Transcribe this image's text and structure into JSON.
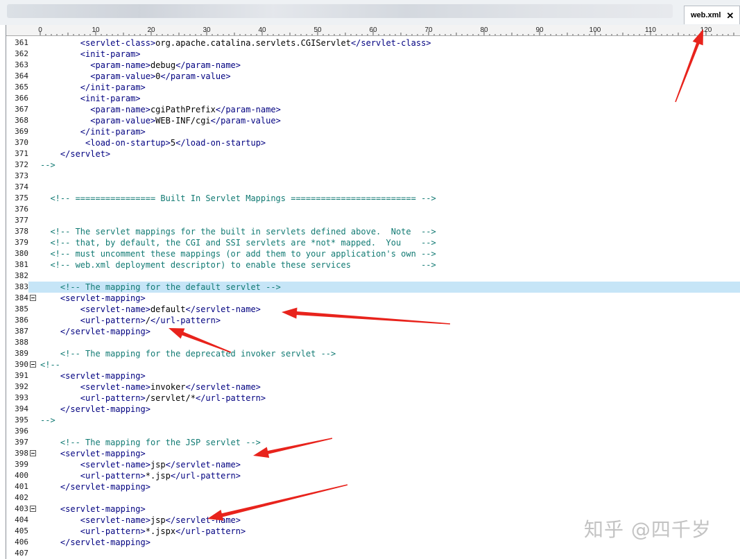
{
  "tab": {
    "title": "web.xml",
    "close": "✕"
  },
  "ruler": {
    "labels": [
      "0",
      "10",
      "20",
      "30",
      "40",
      "50",
      "60",
      "70",
      "80",
      "90",
      "100",
      "110",
      "120"
    ]
  },
  "lines": [
    {
      "n": "361",
      "indent": 8,
      "parts": [
        [
          "t",
          "<servlet-class>"
        ],
        [
          "x",
          "org.apache.catalina.servlets.CGIServlet"
        ],
        [
          "t",
          "</servlet-class>"
        ]
      ]
    },
    {
      "n": "362",
      "indent": 8,
      "parts": [
        [
          "t",
          "<init-param>"
        ]
      ]
    },
    {
      "n": "363",
      "indent": 10,
      "parts": [
        [
          "t",
          "<param-name>"
        ],
        [
          "x",
          "debug"
        ],
        [
          "t",
          "</param-name>"
        ]
      ]
    },
    {
      "n": "364",
      "indent": 10,
      "parts": [
        [
          "t",
          "<param-value>"
        ],
        [
          "x",
          "0"
        ],
        [
          "t",
          "</param-value>"
        ]
      ]
    },
    {
      "n": "365",
      "indent": 8,
      "parts": [
        [
          "t",
          "</init-param>"
        ]
      ]
    },
    {
      "n": "366",
      "indent": 8,
      "parts": [
        [
          "t",
          "<init-param>"
        ]
      ]
    },
    {
      "n": "367",
      "indent": 10,
      "parts": [
        [
          "t",
          "<param-name>"
        ],
        [
          "x",
          "cgiPathPrefix"
        ],
        [
          "t",
          "</param-name>"
        ]
      ]
    },
    {
      "n": "368",
      "indent": 10,
      "parts": [
        [
          "t",
          "<param-value>"
        ],
        [
          "x",
          "WEB-INF/cgi"
        ],
        [
          "t",
          "</param-value>"
        ]
      ]
    },
    {
      "n": "369",
      "indent": 8,
      "parts": [
        [
          "t",
          "</init-param>"
        ]
      ]
    },
    {
      "n": "370",
      "indent": 9,
      "parts": [
        [
          "t",
          "<load-on-startup>"
        ],
        [
          "x",
          "5"
        ],
        [
          "t",
          "</load-on-startup>"
        ]
      ]
    },
    {
      "n": "371",
      "indent": 4,
      "parts": [
        [
          "t",
          "</servlet>"
        ]
      ]
    },
    {
      "n": "372",
      "indent": 0,
      "parts": [
        [
          "c",
          "-->"
        ]
      ]
    },
    {
      "n": "373",
      "indent": 0,
      "parts": []
    },
    {
      "n": "374",
      "indent": 0,
      "parts": []
    },
    {
      "n": "375",
      "indent": 2,
      "parts": [
        [
          "c",
          "<!-- ================ Built In Servlet Mappings ========================= -->"
        ]
      ]
    },
    {
      "n": "376",
      "indent": 0,
      "parts": []
    },
    {
      "n": "377",
      "indent": 0,
      "parts": []
    },
    {
      "n": "378",
      "indent": 2,
      "parts": [
        [
          "c",
          "<!-- The servlet mappings for the built in servlets defined above.  Note  -->"
        ]
      ]
    },
    {
      "n": "379",
      "indent": 2,
      "parts": [
        [
          "c",
          "<!-- that, by default, the CGI and SSI servlets are *not* mapped.  You    -->"
        ]
      ]
    },
    {
      "n": "380",
      "indent": 2,
      "parts": [
        [
          "c",
          "<!-- must uncomment these mappings (or add them to your application's own -->"
        ]
      ]
    },
    {
      "n": "381",
      "indent": 2,
      "parts": [
        [
          "c",
          "<!-- web.xml deployment descriptor) to enable these services              -->"
        ]
      ]
    },
    {
      "n": "382",
      "indent": 0,
      "parts": []
    },
    {
      "n": "383",
      "indent": 4,
      "hl": true,
      "parts": [
        [
          "c",
          "<!-- The mapping for the default servlet -->"
        ]
      ]
    },
    {
      "n": "384",
      "indent": 4,
      "fold": true,
      "parts": [
        [
          "t",
          "<servlet-mapping>"
        ]
      ]
    },
    {
      "n": "385",
      "indent": 8,
      "parts": [
        [
          "t",
          "<servlet-name>"
        ],
        [
          "x",
          "default"
        ],
        [
          "t",
          "</servlet-name>"
        ]
      ]
    },
    {
      "n": "386",
      "indent": 8,
      "parts": [
        [
          "t",
          "<url-pattern>"
        ],
        [
          "x",
          "/"
        ],
        [
          "t",
          "</url-pattern>"
        ]
      ]
    },
    {
      "n": "387",
      "indent": 4,
      "parts": [
        [
          "t",
          "</servlet-mapping>"
        ]
      ]
    },
    {
      "n": "388",
      "indent": 0,
      "parts": []
    },
    {
      "n": "389",
      "indent": 4,
      "parts": [
        [
          "c",
          "<!-- The mapping for the deprecated invoker servlet -->"
        ]
      ]
    },
    {
      "n": "390",
      "indent": 0,
      "fold": true,
      "parts": [
        [
          "c",
          "<!--"
        ]
      ]
    },
    {
      "n": "391",
      "indent": 4,
      "parts": [
        [
          "t",
          "<servlet-mapping>"
        ]
      ]
    },
    {
      "n": "392",
      "indent": 8,
      "parts": [
        [
          "t",
          "<servlet-name>"
        ],
        [
          "x",
          "invoker"
        ],
        [
          "t",
          "</servlet-name>"
        ]
      ]
    },
    {
      "n": "393",
      "indent": 8,
      "parts": [
        [
          "t",
          "<url-pattern>"
        ],
        [
          "x",
          "/servlet/*"
        ],
        [
          "t",
          "</url-pattern>"
        ]
      ]
    },
    {
      "n": "394",
      "indent": 4,
      "parts": [
        [
          "t",
          "</servlet-mapping>"
        ]
      ]
    },
    {
      "n": "395",
      "indent": 0,
      "parts": [
        [
          "c",
          "-->"
        ]
      ]
    },
    {
      "n": "396",
      "indent": 0,
      "parts": []
    },
    {
      "n": "397",
      "indent": 4,
      "parts": [
        [
          "c",
          "<!-- The mapping for the JSP servlet -->"
        ]
      ]
    },
    {
      "n": "398",
      "indent": 4,
      "fold": true,
      "parts": [
        [
          "t",
          "<servlet-mapping>"
        ]
      ]
    },
    {
      "n": "399",
      "indent": 8,
      "parts": [
        [
          "t",
          "<servlet-name>"
        ],
        [
          "x",
          "jsp"
        ],
        [
          "t",
          "</servlet-name>"
        ]
      ]
    },
    {
      "n": "400",
      "indent": 8,
      "parts": [
        [
          "t",
          "<url-pattern>"
        ],
        [
          "x",
          "*.jsp"
        ],
        [
          "t",
          "</url-pattern>"
        ]
      ]
    },
    {
      "n": "401",
      "indent": 4,
      "parts": [
        [
          "t",
          "</servlet-mapping>"
        ]
      ]
    },
    {
      "n": "402",
      "indent": 0,
      "parts": []
    },
    {
      "n": "403",
      "indent": 4,
      "fold": true,
      "parts": [
        [
          "t",
          "<servlet-mapping>"
        ]
      ]
    },
    {
      "n": "404",
      "indent": 8,
      "parts": [
        [
          "t",
          "<servlet-name>"
        ],
        [
          "x",
          "jsp"
        ],
        [
          "t",
          "</servlet-name>"
        ]
      ]
    },
    {
      "n": "405",
      "indent": 8,
      "parts": [
        [
          "t",
          "<url-pattern>"
        ],
        [
          "x",
          "*.jspx"
        ],
        [
          "t",
          "</url-pattern>"
        ]
      ]
    },
    {
      "n": "406",
      "indent": 4,
      "parts": [
        [
          "t",
          "</servlet-mapping>"
        ]
      ]
    },
    {
      "n": "407",
      "indent": 0,
      "parts": []
    }
  ],
  "colors": {
    "tag": "#000080",
    "comment": "#117a73",
    "text": "#000000",
    "highlight": "#c6e5f7",
    "annotation": "#e8231c"
  },
  "watermark": "知乎 @四千岁"
}
